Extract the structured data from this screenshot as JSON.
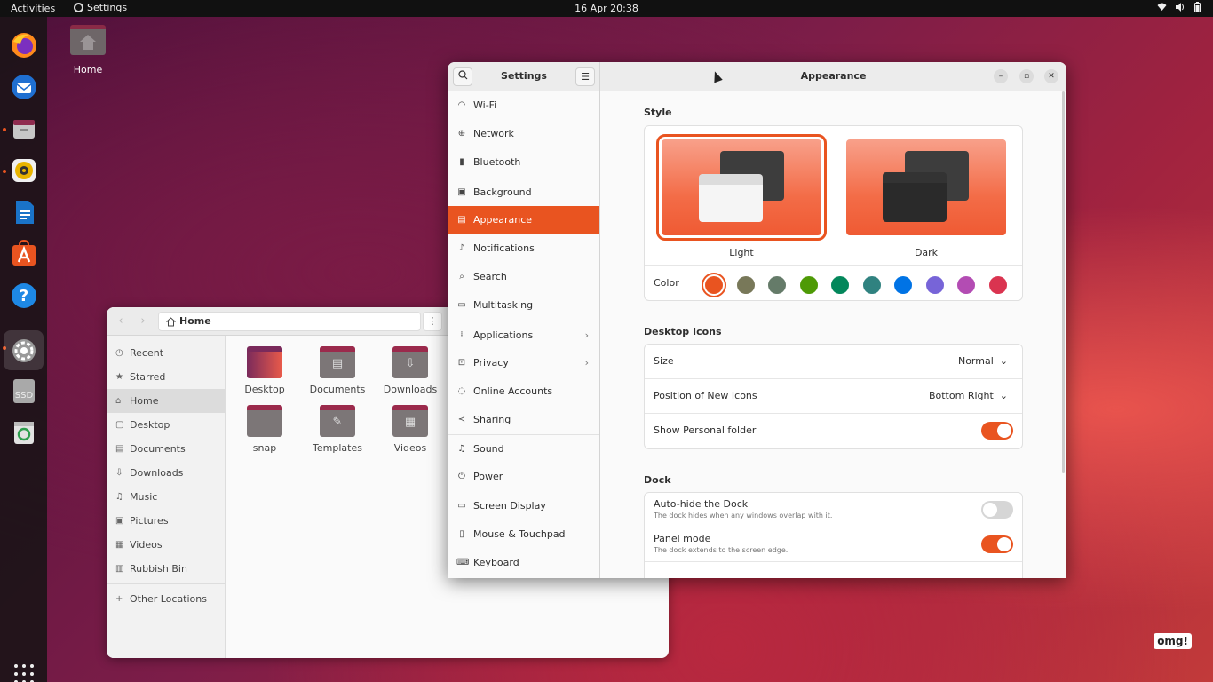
{
  "topbar": {
    "activities": "Activities",
    "app_name": "Settings",
    "clock": "16 Apr  20:38"
  },
  "desktop": {
    "home_label": "Home"
  },
  "dock": {
    "items": [
      "firefox-icon",
      "thunderbird-icon",
      "files-icon",
      "rhythmbox-icon",
      "writer-icon",
      "software-icon",
      "help-icon",
      "settings-icon",
      "ssd-icon",
      "trash-icon"
    ],
    "ssd_label": "SSD"
  },
  "files": {
    "path": "Home",
    "sidebar": [
      {
        "label": "Recent",
        "icon": "clock-icon"
      },
      {
        "label": "Starred",
        "icon": "star-icon"
      },
      {
        "label": "Home",
        "icon": "home-icon"
      },
      {
        "label": "Desktop",
        "icon": "desktop-icon"
      },
      {
        "label": "Documents",
        "icon": "documents-icon"
      },
      {
        "label": "Downloads",
        "icon": "downloads-icon"
      },
      {
        "label": "Music",
        "icon": "music-icon"
      },
      {
        "label": "Pictures",
        "icon": "pictures-icon"
      },
      {
        "label": "Videos",
        "icon": "videos-icon"
      },
      {
        "label": "Rubbish Bin",
        "icon": "trash-icon"
      },
      {
        "label": "Other Locations",
        "icon": "plus-icon"
      }
    ],
    "folders": [
      "Desktop",
      "Documents",
      "Downloads",
      "snap",
      "Templates",
      "Videos"
    ]
  },
  "settings": {
    "sidebar_title": "Settings",
    "page_title": "Appearance",
    "nav": [
      {
        "label": "Wi-Fi",
        "icon": "wifi-icon"
      },
      {
        "label": "Network",
        "icon": "network-icon"
      },
      {
        "label": "Bluetooth",
        "icon": "bluetooth-icon"
      },
      {
        "label": "Background",
        "icon": "background-icon"
      },
      {
        "label": "Appearance",
        "icon": "appearance-icon"
      },
      {
        "label": "Notifications",
        "icon": "bell-icon"
      },
      {
        "label": "Search",
        "icon": "search-icon"
      },
      {
        "label": "Multitasking",
        "icon": "multitasking-icon"
      },
      {
        "label": "Applications",
        "icon": "applications-icon"
      },
      {
        "label": "Privacy",
        "icon": "lock-icon"
      },
      {
        "label": "Online Accounts",
        "icon": "cloud-icon"
      },
      {
        "label": "Sharing",
        "icon": "share-icon"
      },
      {
        "label": "Sound",
        "icon": "music-note-icon"
      },
      {
        "label": "Power",
        "icon": "power-icon"
      },
      {
        "label": "Screen Display",
        "icon": "display-icon"
      },
      {
        "label": "Mouse & Touchpad",
        "icon": "mouse-icon"
      },
      {
        "label": "Keyboard",
        "icon": "keyboard-icon"
      }
    ],
    "style": {
      "title": "Style",
      "light_label": "Light",
      "dark_label": "Dark",
      "color_label": "Color",
      "colors": [
        "#e95420",
        "#787859",
        "#657b69",
        "#4e9a06",
        "#03875b",
        "#308280",
        "#0073e5",
        "#7764d8",
        "#b34cb3",
        "#da3450"
      ]
    },
    "desktop_icons": {
      "title": "Desktop Icons",
      "size_label": "Size",
      "size_value": "Normal",
      "position_label": "Position of New Icons",
      "position_value": "Bottom Right",
      "personal_label": "Show Personal folder"
    },
    "dock": {
      "title": "Dock",
      "autohide_label": "Auto-hide the Dock",
      "autohide_sub": "The dock hides when any windows overlap with it.",
      "panel_label": "Panel mode",
      "panel_sub": "The dock extends to the screen edge."
    }
  },
  "watermark": "omg!"
}
